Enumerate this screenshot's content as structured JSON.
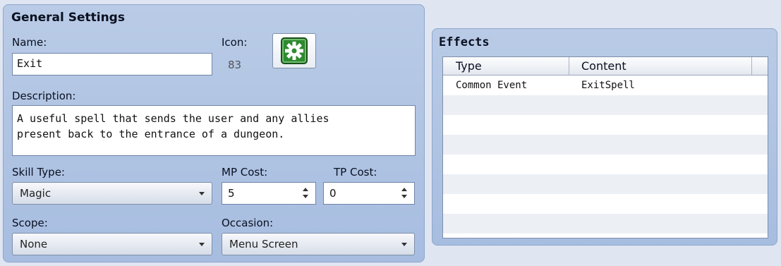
{
  "general": {
    "title": "General Settings",
    "name_label": "Name:",
    "name_value": "Exit",
    "icon_label": "Icon:",
    "icon_index": "83",
    "description_label": "Description:",
    "description_line1": "A useful spell that sends the user and any allies",
    "description_line2": "present back to the entrance of a dungeon.",
    "skill_type_label": "Skill Type:",
    "skill_type_value": "Magic",
    "mp_cost_label": "MP Cost:",
    "mp_cost_value": "5",
    "tp_cost_label": "TP Cost:",
    "tp_cost_value": "0",
    "scope_label": "Scope:",
    "scope_value": "None",
    "occasion_label": "Occasion:",
    "occasion_value": "Menu Screen"
  },
  "effects": {
    "title": "Effects",
    "columns": [
      "Type",
      "Content"
    ],
    "rows": [
      {
        "type": "Common Event",
        "content": "ExitSpell"
      },
      {
        "type": "",
        "content": ""
      },
      {
        "type": "",
        "content": ""
      },
      {
        "type": "",
        "content": ""
      },
      {
        "type": "",
        "content": ""
      },
      {
        "type": "",
        "content": ""
      },
      {
        "type": "",
        "content": ""
      },
      {
        "type": "",
        "content": ""
      }
    ]
  },
  "colors": {
    "panel": "#b0c4e3",
    "background": "#dfe6f2",
    "icon_green": "#2f8a2f"
  },
  "icons": {
    "skill_icon": "gear-icon"
  }
}
